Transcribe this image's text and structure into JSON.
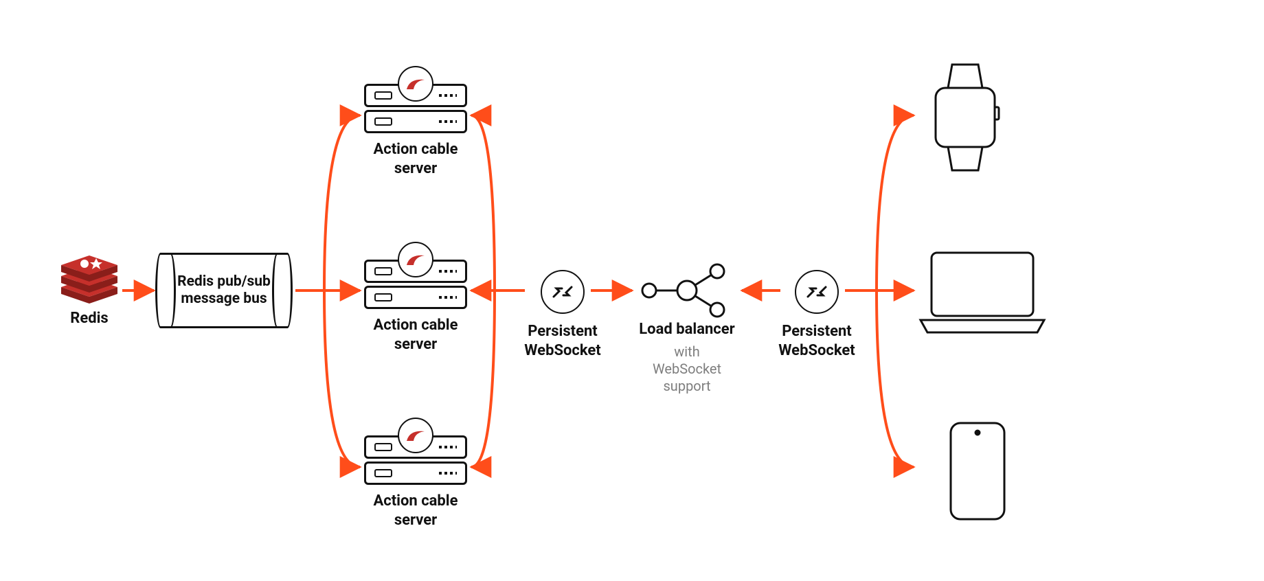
{
  "colors": {
    "arrow": "#ff4d1a",
    "outline": "#111111",
    "redis": "#c6302b",
    "muted": "#7e7e7e"
  },
  "redis": {
    "label": "Redis"
  },
  "bus": {
    "label_line1": "Redis pub/sub",
    "label_line2": "message bus"
  },
  "action_cable": {
    "label_line1": "Action cable",
    "label_line2": "server"
  },
  "ws": {
    "label_line1": "Persistent",
    "label_line2": "WebSocket"
  },
  "lb": {
    "label": "Load balancer",
    "sub_line1": "with",
    "sub_line2": "WebSocket",
    "sub_line3": "support"
  },
  "devices": {
    "watch": "smartwatch-icon",
    "laptop": "laptop-icon",
    "phone": "phone-icon"
  }
}
